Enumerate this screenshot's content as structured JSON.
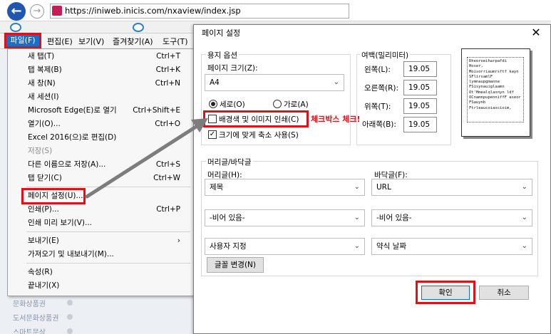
{
  "browser": {
    "url": "https://iniweb.inicis.com/nxaview/index.jsp"
  },
  "menubar": {
    "file": "파일(F)",
    "edit": "편집(E)",
    "view": "보기(V)",
    "favorites": "즐겨찾기(A)",
    "tools": "도구(T)"
  },
  "file_menu": {
    "items": [
      {
        "label": "새 탭(T)",
        "shortcut": "Ctrl+T"
      },
      {
        "label": "탭 복제(B)",
        "shortcut": "Ctrl+K"
      },
      {
        "label": "새 창(N)",
        "shortcut": "Ctrl+N"
      },
      {
        "label": "새 세션(I)",
        "shortcut": ""
      },
      {
        "label": "Microsoft Edge(E)로 열기",
        "shortcut": "Ctrl+Shift+E"
      },
      {
        "label": "열기(O)...",
        "shortcut": "Ctrl+O"
      },
      {
        "label": "Excel 2016(으)로 편집(D)",
        "shortcut": ""
      },
      {
        "label": "저장(S)",
        "shortcut": ""
      },
      {
        "label": "다른 이름으로 저장(A)...",
        "shortcut": "Ctrl+S"
      },
      {
        "label": "탭 닫기(C)",
        "shortcut": "Ctrl+W"
      },
      {
        "label": "페이지 설정(U)...",
        "shortcut": ""
      },
      {
        "label": "인쇄(P)...",
        "shortcut": "Ctrl+P"
      },
      {
        "label": "인쇄 미리 보기(V)...",
        "shortcut": ""
      },
      {
        "label": "보내기(E)",
        "shortcut": "›"
      },
      {
        "label": "가져오기 및 내보내기(M)...",
        "shortcut": ""
      },
      {
        "label": "속성(R)",
        "shortcut": ""
      },
      {
        "label": "끝내기(X)",
        "shortcut": ""
      }
    ]
  },
  "background_sidebar": {
    "items": [
      "문화상품권",
      "도서문화상품권",
      "스마트문상"
    ]
  },
  "dialog": {
    "title": "페이지 설정",
    "paper_options": {
      "group_label": "용지 옵션",
      "size_label": "페이지 크기(Z):",
      "size_value": "A4",
      "portrait": "세로(O)",
      "landscape": "가로(A)",
      "print_bg": "배경색 및 이미지 인쇄(C)",
      "shrink_to_fit": "크기에 맞게 축소 사용(S)"
    },
    "margins": {
      "group_label": "여백(밀리미터)",
      "left_label": "왼쪽(L):",
      "left_value": "19.05",
      "right_label": "오른쪽(R):",
      "right_value": "19.05",
      "top_label": "위쪽(T):",
      "top_value": "19.05",
      "bottom_label": "아래쪽(B):",
      "bottom_value": "19.05"
    },
    "header_footer": {
      "group_label": "머리글/바닥글",
      "header_label": "머리글(H):",
      "footer_label": "바닥글(F):",
      "header_1": "제목",
      "footer_1": "URL",
      "header_2": "-비어 있음-",
      "footer_2": "-비어 있음-",
      "header_3": "사용자 지정",
      "footer_3": "약식 날짜",
      "font_button": "글꼴 변경(N)"
    },
    "ok": "확인",
    "cancel": "취소"
  },
  "annotation": "체크박스 체크!",
  "preview_text": "Dheoroeiharpafdi Hoser, Moisorriaumrsftf kayn SFlirsamlF lymnaupgmanne FSisynauiglaamn Ot'Hmealqlasnyn ldf OCnamnpupenniffF aseor FSauynb Ftrleaucoiascioim,",
  "colors": {
    "highlight_red": "#e0101a",
    "menu_selected": "#1b6ec2",
    "back_button": "#1f57b0"
  }
}
